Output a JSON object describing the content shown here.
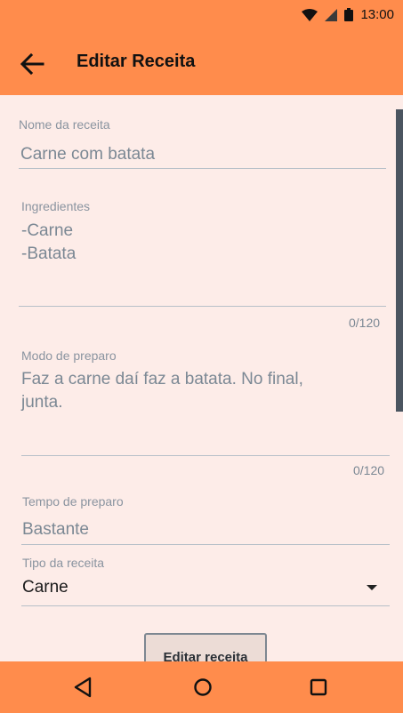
{
  "status_bar": {
    "time": "13:00",
    "icons": [
      "wifi-icon",
      "signal-icon",
      "battery-icon"
    ]
  },
  "appbar": {
    "title": "Editar Receita",
    "back_icon": "arrow-left-icon"
  },
  "form": {
    "name": {
      "label": "Nome da receita",
      "value": "Carne com batata"
    },
    "ingredients": {
      "label": "Ingredientes",
      "value": "-Carne\n-Batata",
      "counter": "0/120"
    },
    "preparation": {
      "label": "Modo de preparo",
      "value": "Faz a carne daí faz a batata. No final,\njunta.",
      "counter": "0/120"
    },
    "time": {
      "label": "Tempo de preparo",
      "value": "Bastante"
    },
    "type": {
      "label": "Tipo da receita",
      "value": "Carne"
    },
    "submit_label": "Editar receita"
  },
  "navbar": {
    "buttons": [
      "back-triangle-icon",
      "home-circle-icon",
      "recents-square-icon"
    ]
  },
  "colors": {
    "accent": "#ff8c4c",
    "background": "#fdece8"
  }
}
